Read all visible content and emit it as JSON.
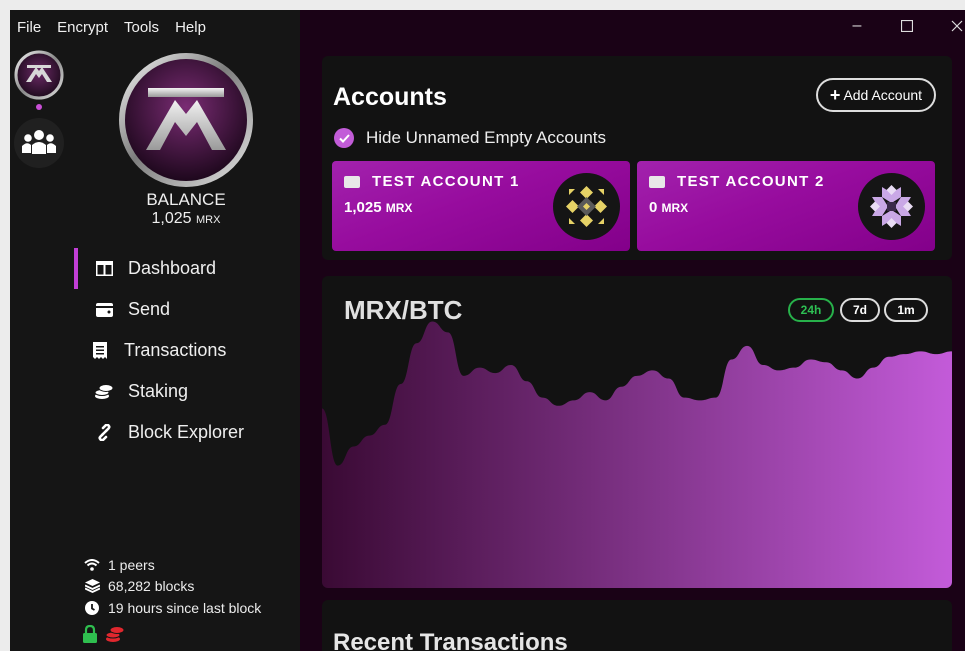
{
  "menu": [
    "File",
    "Encrypt",
    "Tools",
    "Help"
  ],
  "window_controls": {
    "minimize": "–",
    "maximize": "☐",
    "close": "✕"
  },
  "balance": {
    "label": "BALANCE",
    "amount": "1,025",
    "unit": "MRX"
  },
  "nav": [
    {
      "label": "Dashboard",
      "icon": "columns-icon",
      "active": true
    },
    {
      "label": "Send",
      "icon": "wallet-icon",
      "active": false
    },
    {
      "label": "Transactions",
      "icon": "receipt-icon",
      "active": false
    },
    {
      "label": "Staking",
      "icon": "coins-icon",
      "active": false
    },
    {
      "label": "Block Explorer",
      "icon": "link-icon",
      "active": false
    }
  ],
  "status": {
    "peers": "1 peers",
    "blocks": "68,282 blocks",
    "last_block": "19 hours since last block"
  },
  "accounts": {
    "title": "Accounts",
    "add_button": "Add Account",
    "hide_empty_label": "Hide Unnamed Empty Accounts",
    "hide_empty_checked": true,
    "list": [
      {
        "name": "TEST ACCOUNT 1",
        "amount": "1,025",
        "unit": "MRX"
      },
      {
        "name": "TEST ACCOUNT 2",
        "amount": "0",
        "unit": "MRX"
      }
    ]
  },
  "chart": {
    "title": "MRX/BTC",
    "timeframes": [
      "24h",
      "7d",
      "1m"
    ],
    "active_timeframe": "24h"
  },
  "chart_data": {
    "type": "area",
    "title": "MRX/BTC",
    "x": [
      0,
      1,
      2,
      3,
      4,
      5,
      6,
      7,
      8,
      9,
      10,
      11,
      12,
      13,
      14,
      15,
      16,
      17,
      18,
      19,
      20,
      21,
      22,
      23,
      24,
      25,
      26,
      27,
      28,
      29,
      30,
      31,
      32,
      33,
      34,
      35,
      36,
      37,
      38,
      39,
      40
    ],
    "values": [
      0.66,
      0.45,
      0.52,
      0.56,
      0.6,
      0.75,
      0.9,
      0.98,
      0.94,
      0.78,
      0.81,
      0.79,
      0.82,
      0.76,
      0.7,
      0.67,
      0.69,
      0.72,
      0.69,
      0.74,
      0.78,
      0.8,
      0.77,
      0.7,
      0.69,
      0.7,
      0.84,
      0.89,
      0.82,
      0.8,
      0.81,
      0.84,
      0.83,
      0.8,
      0.77,
      0.81,
      0.85,
      0.86,
      0.87,
      0.86,
      0.87
    ],
    "ylim": [
      0,
      1
    ],
    "grid": false,
    "colors": {
      "start": "#3a0a34",
      "end": "#c35bd9"
    }
  },
  "recent": {
    "title": "Recent Transactions"
  },
  "colors": {
    "accent": "#c13ed6",
    "card": "#9a15a3",
    "active_tf": "#27b14a",
    "background": "#1a0216"
  }
}
